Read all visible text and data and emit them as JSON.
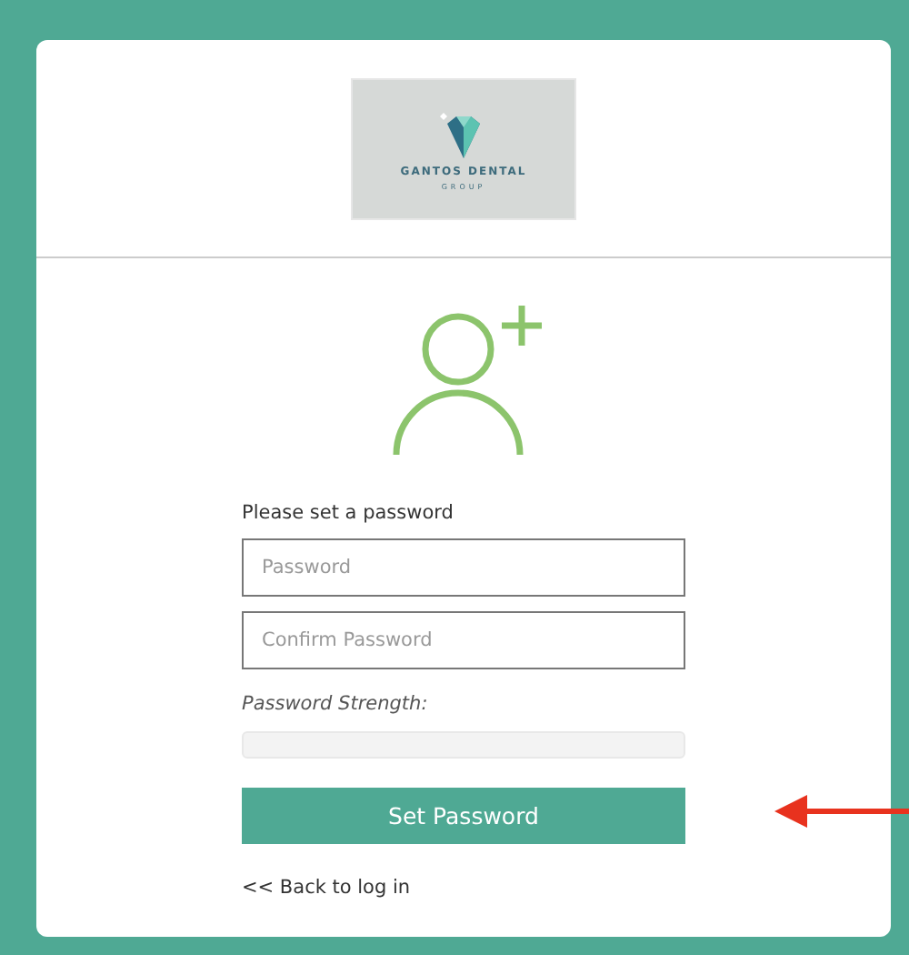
{
  "logo": {
    "name": "GANTOS DENTAL",
    "subtitle": "GROUP"
  },
  "form": {
    "prompt": "Please set a password",
    "fields": [
      {
        "placeholder": "Password"
      },
      {
        "placeholder": "Confirm Password"
      }
    ],
    "strength": {
      "label": "Password Strength:",
      "level": 0
    },
    "submit": "Set Password",
    "back_link": "<< Back to log in"
  }
}
